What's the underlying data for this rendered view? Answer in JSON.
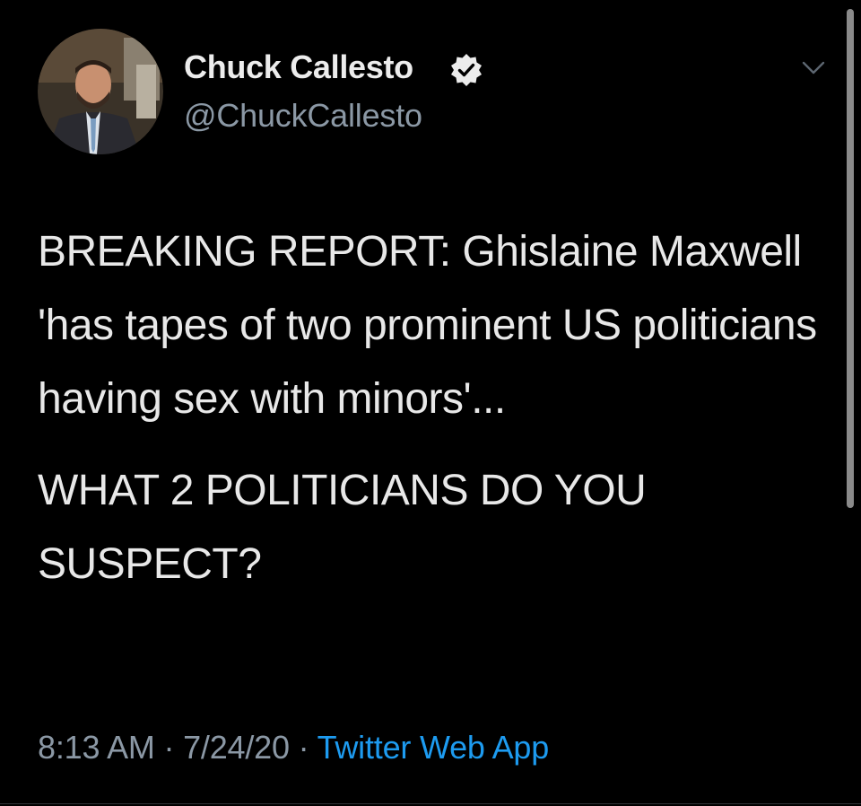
{
  "tweet": {
    "author": {
      "name": "Chuck Callesto",
      "handle": "@ChuckCallesto",
      "verified_icon": "verified-badge-icon"
    },
    "menu_icon": "chevron-down-icon",
    "text": {
      "paragraph1": "BREAKING REPORT: Ghislaine Maxwell 'has tapes of two prominent US politicians having sex with minors'...",
      "paragraph2": "WHAT 2 POLITICIANS DO YOU SUSPECT?"
    },
    "meta": {
      "time": "8:13 AM",
      "separator1": " · ",
      "date": "7/24/20",
      "separator2": " · ",
      "source": "Twitter Web App"
    }
  },
  "colors": {
    "background": "#000000",
    "text": "#e8e8e8",
    "secondary_text": "#8b98a5",
    "link": "#1d9bf0"
  }
}
